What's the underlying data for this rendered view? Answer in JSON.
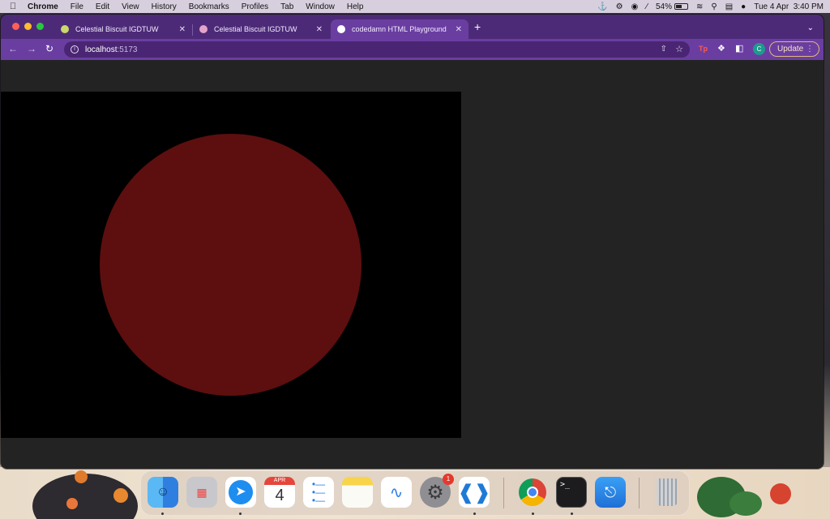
{
  "menubar": {
    "app_name": "Chrome",
    "menus": [
      "File",
      "Edit",
      "View",
      "History",
      "Bookmarks",
      "Profiles",
      "Tab",
      "Window",
      "Help"
    ],
    "battery_percent": "54%",
    "battery_level": 0.54,
    "datetime": "Tue 4 Apr  3:40 PM"
  },
  "browser": {
    "tabs": [
      {
        "title": "Celestial Biscuit IGDTUW",
        "active": false,
        "favicon_color": "#c9d86b"
      },
      {
        "title": "Celestial Biscuit IGDTUW",
        "active": false,
        "favicon_color": "#e4a3c8"
      },
      {
        "title": "codedamn HTML Playground",
        "active": true,
        "favicon_color": "#ffffff"
      }
    ],
    "url_host": "localhost",
    "url_port": ":5173",
    "update_label": "Update",
    "avatar_initial": "C",
    "extension_tp_label": "Tp"
  },
  "page": {
    "canvas_background": "#000000",
    "circle_color": "#5c0f0e",
    "page_background": "#232323"
  },
  "dock": {
    "calendar_month": "APR",
    "calendar_day": "4",
    "settings_badge": "1"
  },
  "colors": {
    "tabbar": "#4d2a78",
    "toolbar": "#6a3ea1",
    "omnibox": "#4a2573"
  }
}
